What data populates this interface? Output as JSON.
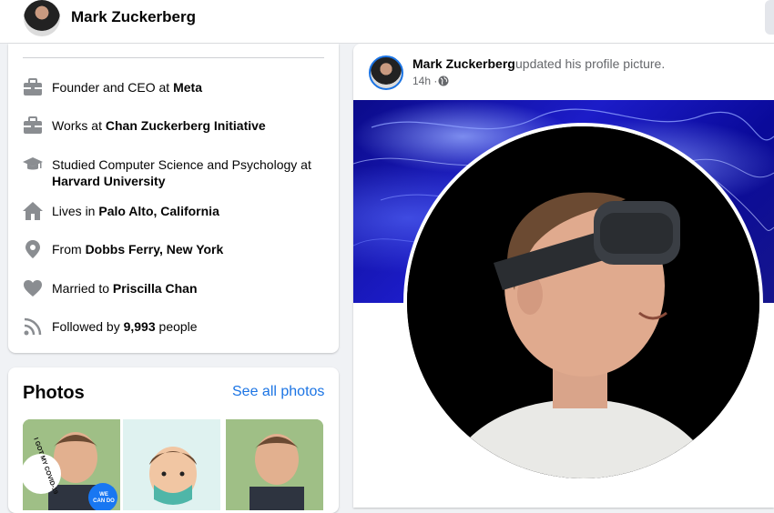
{
  "header": {
    "name": "Mark Zuckerberg"
  },
  "intro": {
    "items": [
      {
        "icon": "briefcase-icon",
        "prefix": "Founder and CEO at ",
        "bold": "Meta",
        "suffix": ""
      },
      {
        "icon": "briefcase-icon",
        "prefix": "Works at ",
        "bold": "Chan Zuckerberg Initiative",
        "suffix": ""
      },
      {
        "icon": "graduation-cap-icon",
        "prefix": "Studied Computer Science and Psychology at",
        "bold": "Harvard University",
        "suffix": ""
      },
      {
        "icon": "home-icon",
        "prefix": "Lives in ",
        "bold": "Palo Alto, California",
        "suffix": ""
      },
      {
        "icon": "location-pin-icon",
        "prefix": "From ",
        "bold": "Dobbs Ferry, New York",
        "suffix": ""
      },
      {
        "icon": "heart-icon",
        "prefix": "Married to ",
        "bold": "Priscilla Chan",
        "suffix": ""
      },
      {
        "icon": "rss-icon",
        "prefix": "Followed by ",
        "bold": "9,993",
        "suffix": " people"
      }
    ]
  },
  "photos": {
    "title": "Photos",
    "see_all": "See all photos",
    "thumb_texts": [
      "I GOT MY COVID-19",
      "WE CAN DO"
    ]
  },
  "post": {
    "author": "Mark Zuckerberg",
    "action": "updated his profile picture.",
    "time": "14h",
    "separator": "·",
    "privacy_icon": "globe-icon"
  },
  "colors": {
    "link": "#1b74e4",
    "secondary_text": "#65676b",
    "background": "#f0f2f5"
  }
}
